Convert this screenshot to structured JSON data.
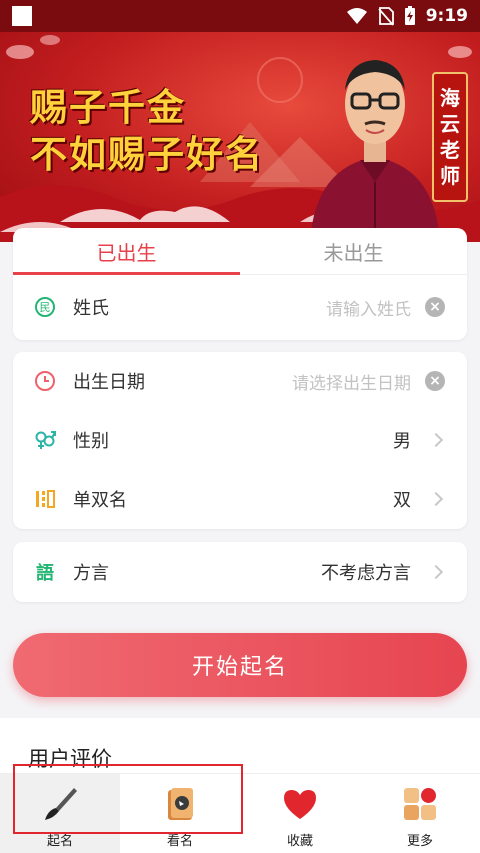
{
  "status_bar": {
    "time": "9:19"
  },
  "banner": {
    "slogan_line1": "赐子千金",
    "slogan_line2": "不如赐子好名",
    "seal_chars": [
      "海",
      "云",
      "老",
      "师"
    ]
  },
  "name_tabs": [
    {
      "label": "已出生",
      "active": true
    },
    {
      "label": "未出生",
      "active": false
    }
  ],
  "surname": {
    "label": "姓氏",
    "placeholder": "请输入姓氏",
    "icon": "surname-icon"
  },
  "birth_date": {
    "label": "出生日期",
    "placeholder": "请选择出生日期",
    "icon": "clock-icon"
  },
  "gender": {
    "label": "性别",
    "value": "男",
    "icon": "gender-icon"
  },
  "name_length": {
    "label": "单双名",
    "value": "双",
    "icon": "name-length-icon"
  },
  "dialect": {
    "label": "方言",
    "value": "不考虑方言",
    "icon": "dialect-icon"
  },
  "start_button": {
    "label": "开始起名"
  },
  "reviews": {
    "title": "用户评价"
  },
  "bottom_nav": [
    {
      "label": "起名",
      "icon": "brush-icon"
    },
    {
      "label": "看名",
      "icon": "scroll-icon"
    },
    {
      "label": "收藏",
      "icon": "heart-icon"
    },
    {
      "label": "更多",
      "icon": "grid-icon"
    }
  ],
  "colors": {
    "accent": "#e8414b",
    "status_bar": "#7a0c10",
    "banner": "#c21d1f",
    "slogan": "#ffd23c"
  }
}
